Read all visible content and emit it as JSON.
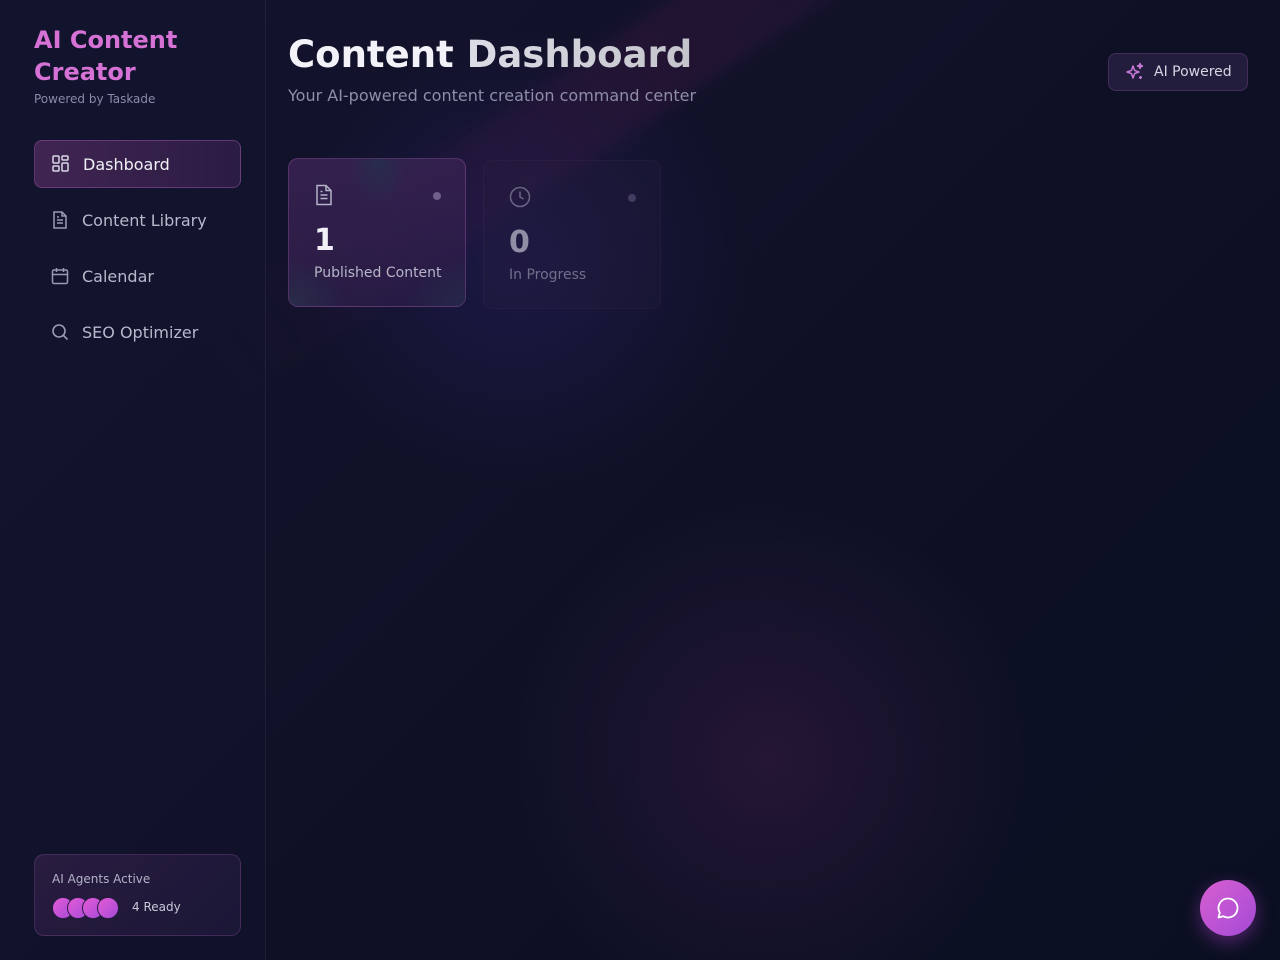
{
  "brand": {
    "title": "AI Content Creator",
    "subtitle": "Powered by Taskade"
  },
  "sidebar": {
    "items": [
      {
        "label": "Dashboard",
        "icon": "dashboard-grid-icon",
        "active": true
      },
      {
        "label": "Content Library",
        "icon": "document-icon",
        "active": false
      },
      {
        "label": "Calendar",
        "icon": "calendar-icon",
        "active": false
      },
      {
        "label": "SEO Optimizer",
        "icon": "search-icon",
        "active": false
      }
    ],
    "agents": {
      "title": "AI Agents Active",
      "status": "4 Ready",
      "count": 4
    }
  },
  "header": {
    "title_part1": "Content",
    "title_part2": "Dashboard",
    "subtitle": "Your AI-powered content creation command center",
    "badge": {
      "label": "AI Powered",
      "icon": "sparkles-icon"
    }
  },
  "stats": [
    {
      "value": "1",
      "label": "Published Content",
      "icon": "document-icon"
    },
    {
      "value": "0",
      "label": "In Progress",
      "icon": "clock-icon"
    }
  ],
  "chat_button": {
    "icon": "chat-bubble-icon"
  },
  "colors": {
    "accent": "#d671d6",
    "background": "#0f1128",
    "sidebar": "#12142c"
  }
}
